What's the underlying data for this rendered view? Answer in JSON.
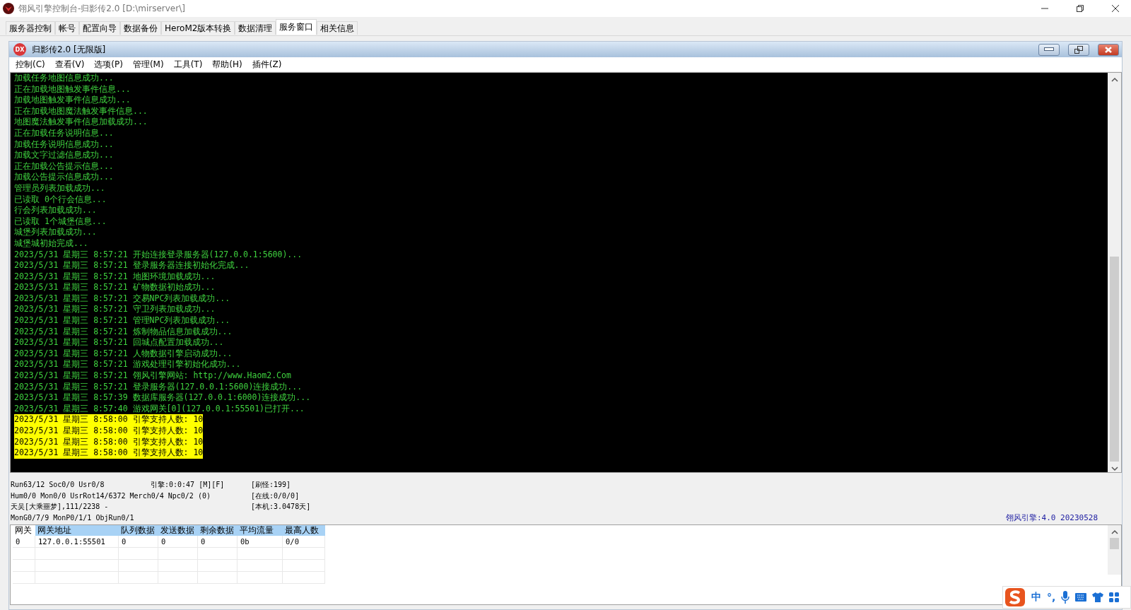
{
  "window": {
    "title": "翎风引擎控制台-归影传2.0 [D:\\mirserver\\]"
  },
  "tabs": [
    {
      "label": "服务器控制",
      "selected": false
    },
    {
      "label": "帐号",
      "selected": false
    },
    {
      "label": "配置向导",
      "selected": false
    },
    {
      "label": "数据备份",
      "selected": false
    },
    {
      "label": "HeroM2版本转换",
      "selected": false
    },
    {
      "label": "数据清理",
      "selected": false
    },
    {
      "label": "服务窗口",
      "selected": true
    },
    {
      "label": "相关信息",
      "selected": false
    }
  ],
  "child_window": {
    "icon_text": "DX",
    "title": "归影传2.0 [无限版]",
    "menu": [
      "控制(C)",
      "查看(V)",
      "选项(P)",
      "管理(M)",
      "工具(T)",
      "帮助(H)",
      "插件(Z)"
    ]
  },
  "console": [
    {
      "text": "加载任务地图信息成功...",
      "highlighted": false
    },
    {
      "text": "正在加载地图触发事件信息...",
      "highlighted": false
    },
    {
      "text": "加载地图触发事件信息成功...",
      "highlighted": false
    },
    {
      "text": "正在加载地图魔法触发事件信息...",
      "highlighted": false
    },
    {
      "text": "地图魔法触发事件信息加载成功...",
      "highlighted": false
    },
    {
      "text": "正在加载任务说明信息...",
      "highlighted": false
    },
    {
      "text": "加载任务说明信息成功...",
      "highlighted": false
    },
    {
      "text": "加载文字过滤信息成功...",
      "highlighted": false
    },
    {
      "text": "正在加载公告提示信息...",
      "highlighted": false
    },
    {
      "text": "加载公告提示信息成功...",
      "highlighted": false
    },
    {
      "text": "管理员列表加载成功...",
      "highlighted": false
    },
    {
      "text": "已读取 0个行会信息...",
      "highlighted": false
    },
    {
      "text": "行会列表加载成功...",
      "highlighted": false
    },
    {
      "text": "已读取 1个城堡信息...",
      "highlighted": false
    },
    {
      "text": "城堡列表加载成功...",
      "highlighted": false
    },
    {
      "text": "城堡城初始完成...",
      "highlighted": false
    },
    {
      "text": "2023/5/31 星期三 8:57:21 开始连接登录服务器(127.0.0.1:5600)...",
      "highlighted": false
    },
    {
      "text": "2023/5/31 星期三 8:57:21 登录服务器连接初始化完成...",
      "highlighted": false
    },
    {
      "text": "2023/5/31 星期三 8:57:21 地图环境加载成功...",
      "highlighted": false
    },
    {
      "text": "2023/5/31 星期三 8:57:21 矿物数据初始成功...",
      "highlighted": false
    },
    {
      "text": "2023/5/31 星期三 8:57:21 交易NPC列表加载成功...",
      "highlighted": false
    },
    {
      "text": "2023/5/31 星期三 8:57:21 守卫列表加载成功...",
      "highlighted": false
    },
    {
      "text": "2023/5/31 星期三 8:57:21 管理NPC列表加载成功...",
      "highlighted": false
    },
    {
      "text": "2023/5/31 星期三 8:57:21 炼制物品信息加载成功...",
      "highlighted": false
    },
    {
      "text": "2023/5/31 星期三 8:57:21 回城点配置加载成功...",
      "highlighted": false
    },
    {
      "text": "2023/5/31 星期三 8:57:21 人物数据引擎启动成功...",
      "highlighted": false
    },
    {
      "text": "2023/5/31 星期三 8:57:21 游戏处理引擎初始化成功...",
      "highlighted": false
    },
    {
      "text": "2023/5/31 星期三 8:57:21 翎风引擎网站: http://www.Haom2.Com",
      "highlighted": false
    },
    {
      "text": "2023/5/31 星期三 8:57:21 登录服务器(127.0.0.1:5600)连接成功...",
      "highlighted": false
    },
    {
      "text": "2023/5/31 星期三 8:57:39 数据库服务器(127.0.0.1:6000)连接成功...",
      "highlighted": false
    },
    {
      "text": "2023/5/31 星期三 8:57:40 游戏网关[0](127.0.0.1:55501)已打开...",
      "highlighted": false
    },
    {
      "text": "2023/5/31 星期三 8:58:00 引擎支持人数: 10",
      "highlighted": true
    },
    {
      "text": "2023/5/31 星期三 8:58:00 引擎支持人数: 10",
      "highlighted": true
    },
    {
      "text": "2023/5/31 星期三 8:58:00 引擎支持人数: 10",
      "highlighted": true
    },
    {
      "text": "2023/5/31 星期三 8:58:00 引擎支持人数: 10",
      "highlighted": true
    }
  ],
  "status": {
    "column_1": [
      "Run63/12 Soc0/0 Usr0/8",
      "Hum0/0 Mon0/0 UsrRot14/6372 Merch0/4 Npc0/2 (0)",
      "天吴[大乘噩梦],111/2238 -",
      "MonG0/7/9 MonP0/1/1 ObjRun0/1"
    ],
    "column_2": [
      "引擎:0:0:47 [M][F]"
    ],
    "column_3": [
      "[刷怪:199]",
      "[在线:0/0/0]",
      "[本机:3.0478天]"
    ],
    "version": "翎风引擎:4.0 20230528"
  },
  "table": {
    "columns": [
      "网关",
      "网关地址",
      "队列数据",
      "发送数据",
      "剩余数据",
      "平均流量",
      "最高人数"
    ],
    "rows": [
      [
        "0",
        "127.0.0.1:55501",
        "0",
        "0",
        "0",
        "0b",
        "0/0"
      ]
    ]
  },
  "ime_bar": {
    "items": [
      "中",
      "°,"
    ]
  }
}
